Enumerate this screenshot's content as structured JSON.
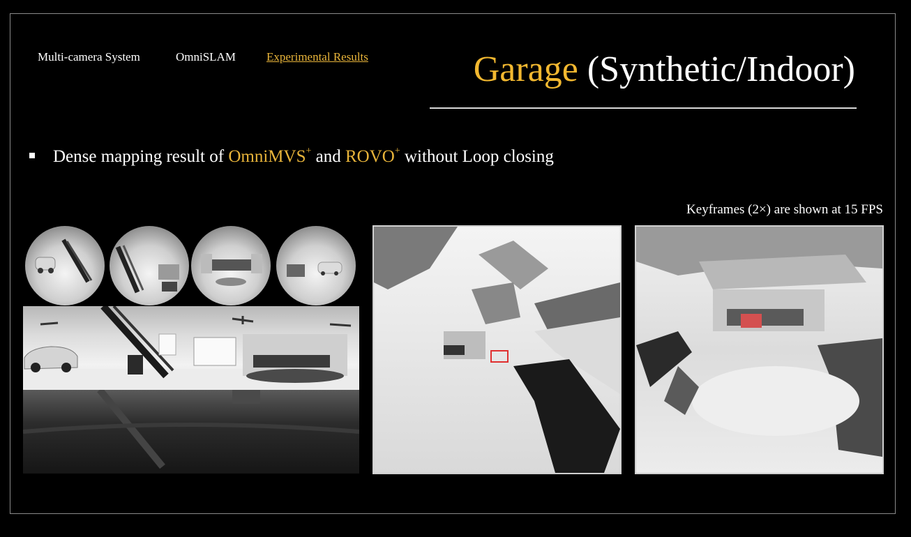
{
  "nav": {
    "items": [
      {
        "label": "Multi-camera System",
        "active": false
      },
      {
        "label": "OmniSLAM",
        "active": false
      },
      {
        "label": "Experimental Results",
        "active": true
      }
    ]
  },
  "title": {
    "accent": "Garage",
    "rest": " (Synthetic/Indoor)"
  },
  "bullet": {
    "prefix": "Dense mapping result of ",
    "method1": "OmniMVS",
    "method1_sup": "+",
    "middle": " and ",
    "method2": "ROVO",
    "method2_sup": "+",
    "suffix": " without Loop closing"
  },
  "caption": "Keyframes (2×) are shown at 15 FPS",
  "colors": {
    "accent": "#f2b830",
    "link": "#e8b43a",
    "background": "#000000",
    "text": "#ffffff"
  }
}
